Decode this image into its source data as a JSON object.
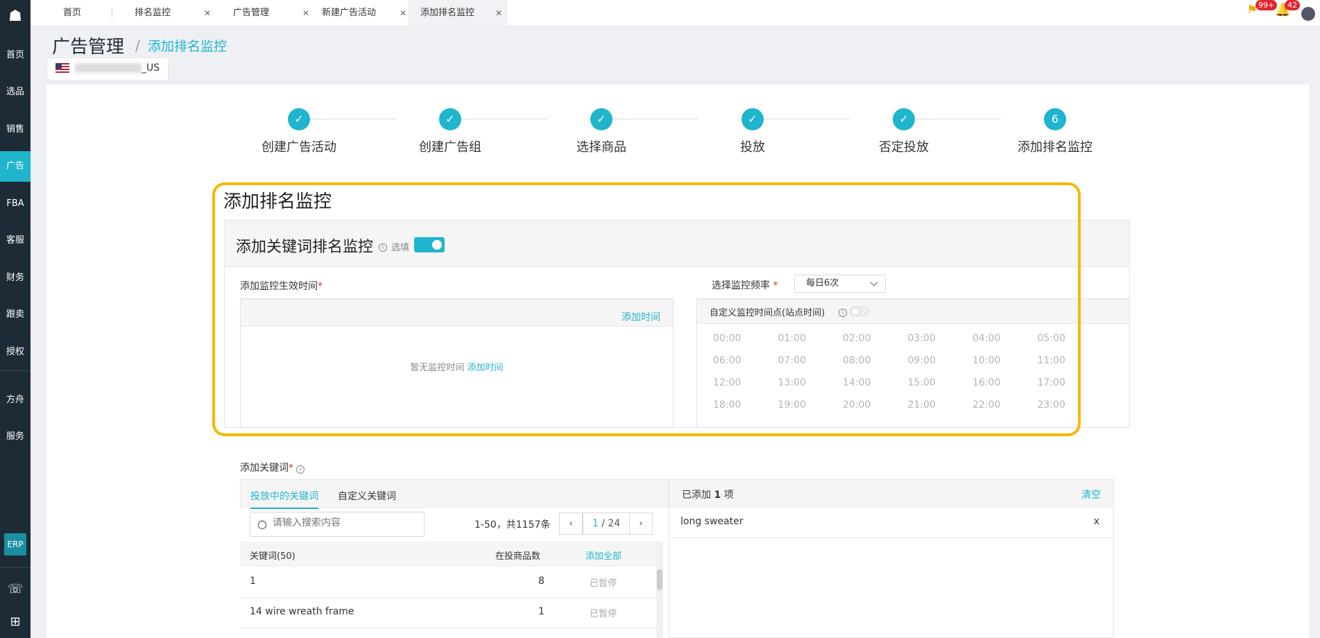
{
  "sidebar": {
    "items": [
      "首页",
      "选品",
      "销售",
      "广告",
      "FBA",
      "客服",
      "财务",
      "跟卖",
      "授权",
      "方舟",
      "服务"
    ],
    "erp": "ERP",
    "active": "广告"
  },
  "tabs": [
    {
      "label": "首页"
    },
    {
      "label": "排名监控"
    },
    {
      "label": "广告管理"
    },
    {
      "label": "新建广告活动"
    },
    {
      "label": "添加排名监控"
    }
  ],
  "top": {
    "flag_badge": "99+",
    "bell_badge": "42"
  },
  "header": {
    "title": "广告管理",
    "slash": "/",
    "sub": "添加排名监控"
  },
  "store": {
    "suffix": "_US"
  },
  "steps": [
    "创建广告活动",
    "创建广告组",
    "选择商品",
    "投放",
    "否定投放",
    "添加排名监控"
  ],
  "step_current_num": "6",
  "section": {
    "title": "添加排名监控",
    "sub_title": "添加关键词排名监控",
    "optional": "选填",
    "effective_time_label": "添加监控生效时间",
    "add_time": "添加时间",
    "empty_text": "暂无监控时间",
    "freq_label": "选择监控频率",
    "freq_value": "每日6次",
    "custom_label": "自定义监控时间点(站点时间)",
    "times": [
      "00:00",
      "01:00",
      "02:00",
      "03:00",
      "04:00",
      "05:00",
      "06:00",
      "07:00",
      "08:00",
      "09:00",
      "10:00",
      "11:00",
      "12:00",
      "13:00",
      "14:00",
      "15:00",
      "16:00",
      "17:00",
      "18:00",
      "19:00",
      "20:00",
      "21:00",
      "22:00",
      "23:00"
    ]
  },
  "keywords": {
    "label": "添加关键词",
    "tab_active": "投放中的关键词",
    "tab_other": "自定义关键词",
    "search_placeholder": "请输入搜索内容",
    "range": "1-50，共1157条",
    "page": "1",
    "total_pages": "/ 24",
    "col_keyword": "关键词(50)",
    "col_count": "在投商品数",
    "add_all": "添加全部",
    "rows": [
      {
        "kw": "1",
        "count": "8",
        "status": "已暂停"
      },
      {
        "kw": "14 wire wreath frame",
        "count": "1",
        "status": "已暂停"
      }
    ],
    "added_prefix": "已添加",
    "added_count": "1",
    "added_suffix": "项",
    "clear": "清空",
    "added_items": [
      {
        "kw": "long sweater",
        "remove": "x"
      }
    ]
  }
}
